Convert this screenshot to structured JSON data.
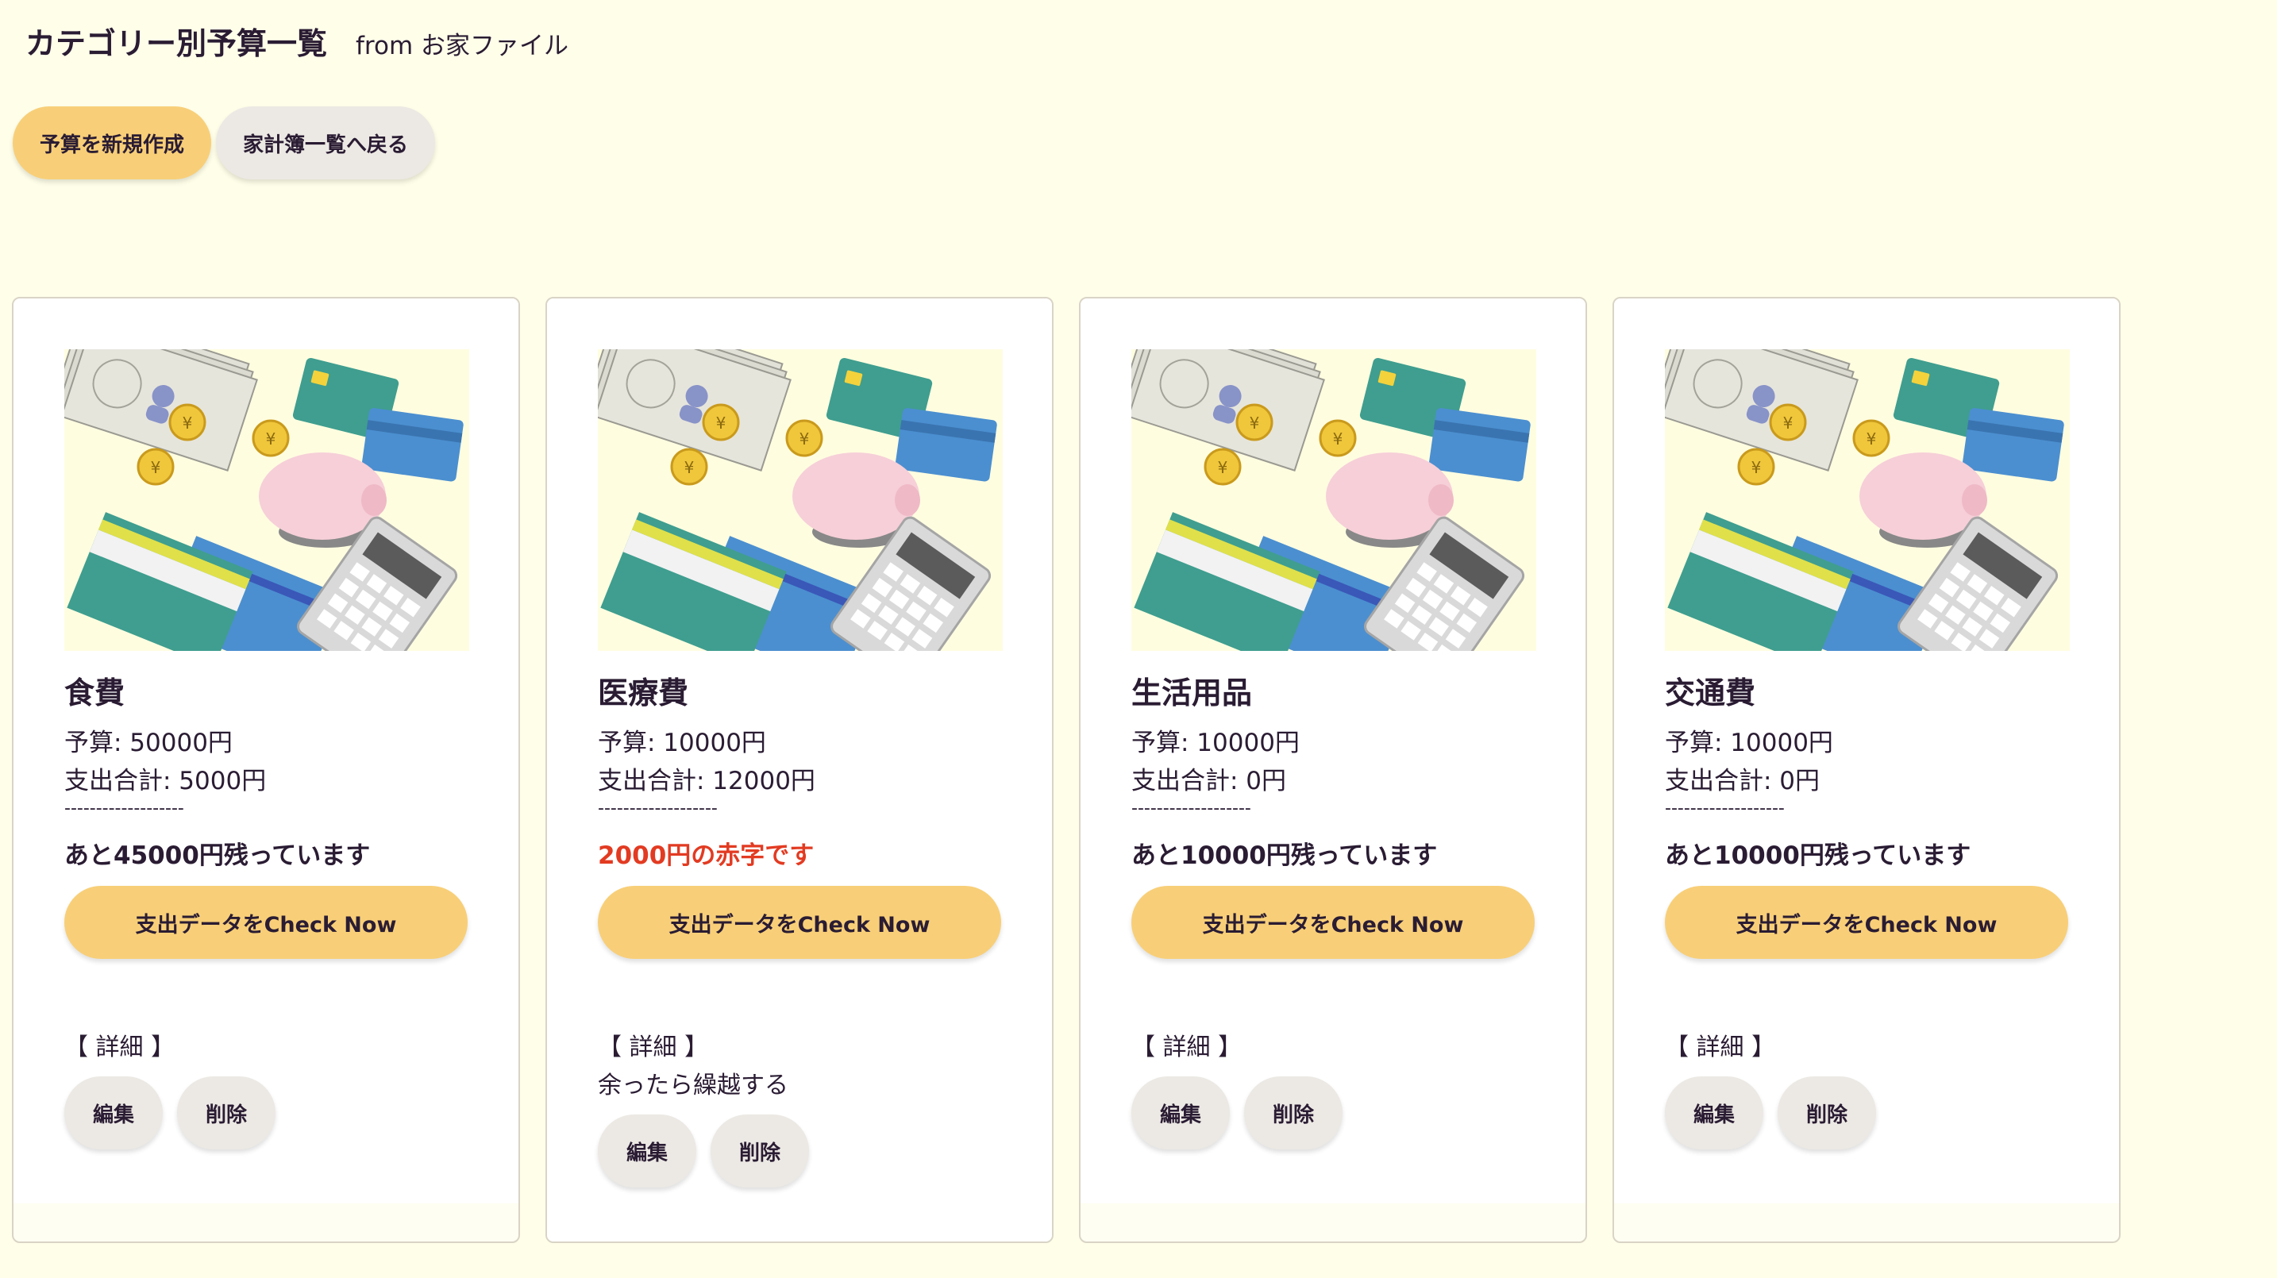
{
  "header": {
    "title": "カテゴリー別予算一覧",
    "subtitle": "from お家ファイル"
  },
  "actions": {
    "create_budget": "予算を新規作成",
    "back_to_list": "家計簿一覧へ戻る"
  },
  "cards": [
    {
      "category": "食費",
      "budget": "予算: 50000円",
      "spent": "支出合計: 5000円",
      "divider": "-------------------",
      "status": "あと45000円残っています",
      "status_type": "remaining",
      "check_button": "支出データをCheck Now",
      "details_label": "【 詳細 】",
      "details_note": "",
      "edit": "編集",
      "delete": "削除"
    },
    {
      "category": "医療費",
      "budget": "予算: 10000円",
      "spent": "支出合計: 12000円",
      "divider": "-------------------",
      "status": "2000円の赤字です",
      "status_type": "deficit",
      "check_button": "支出データをCheck Now",
      "details_label": "【 詳細 】",
      "details_note": "余ったら繰越する",
      "edit": "編集",
      "delete": "削除"
    },
    {
      "category": "生活用品",
      "budget": "予算: 10000円",
      "spent": "支出合計: 0円",
      "divider": "-------------------",
      "status": "あと10000円残っています",
      "status_type": "remaining",
      "check_button": "支出データをCheck Now",
      "details_label": "【 詳細 】",
      "details_note": "",
      "edit": "編集",
      "delete": "削除"
    },
    {
      "category": "交通費",
      "budget": "予算: 10000円",
      "spent": "支出合計: 0円",
      "divider": "-------------------",
      "status": "あと10000円残っています",
      "status_type": "remaining",
      "check_button": "支出データをCheck Now",
      "details_label": "【 詳細 】",
      "details_note": "",
      "edit": "編集",
      "delete": "削除"
    }
  ],
  "colors": {
    "background": "#fefee9",
    "accent": "#f8cf78",
    "secondary_button": "#ece9e4",
    "deficit": "#e23b22",
    "text": "#2a1c33"
  },
  "icons": {
    "card_illustration": "money-piggy-bank-calculator-illustration"
  }
}
